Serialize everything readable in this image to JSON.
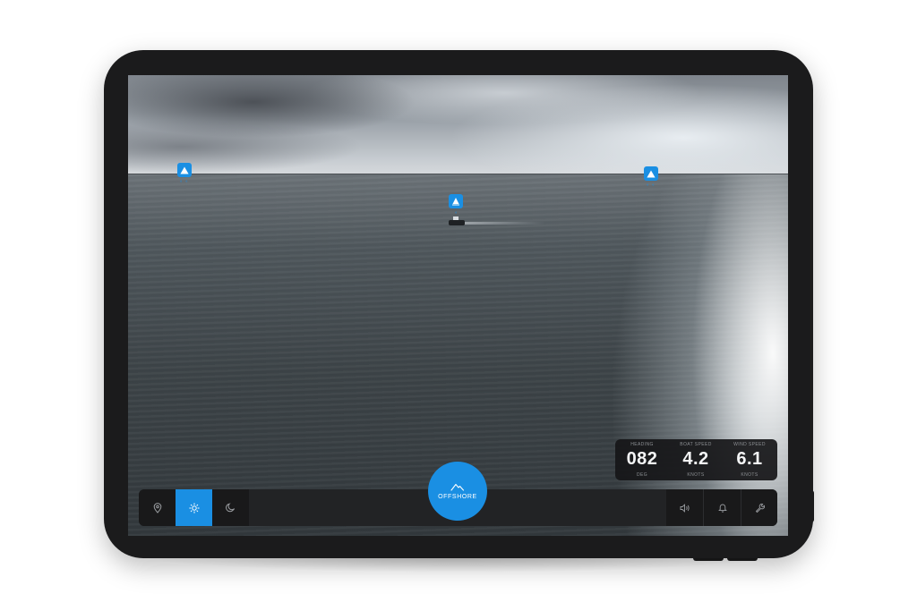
{
  "colors": {
    "accent": "#1a8fe3",
    "panel_bg": "#161618",
    "toolbar_bg": "#222325"
  },
  "markers": [
    {
      "icon": "warning-icon",
      "sub": "° °"
    },
    {
      "icon": "sail-icon",
      "sub": "°"
    },
    {
      "icon": "warning-icon",
      "sub": "° °"
    }
  ],
  "metrics": {
    "heading": {
      "label": "HEADING",
      "value": "082",
      "unit": "DEG"
    },
    "boat_speed": {
      "label": "BOAT SPEED",
      "value": "4.2",
      "unit": "KNOTS"
    },
    "wind_speed": {
      "label": "WIND SPEED",
      "value": "6.1",
      "unit": "KNOTS"
    }
  },
  "mode_button": {
    "label": "OFFSHORE",
    "icon": "mountain-icon"
  },
  "toolbar": {
    "left": [
      {
        "icon": "location-pin-icon",
        "active": false
      },
      {
        "icon": "sun-icon",
        "active": true
      },
      {
        "icon": "moon-icon",
        "active": false
      }
    ],
    "right": [
      {
        "icon": "speaker-icon"
      },
      {
        "icon": "bell-icon"
      },
      {
        "icon": "wrench-icon"
      }
    ]
  }
}
